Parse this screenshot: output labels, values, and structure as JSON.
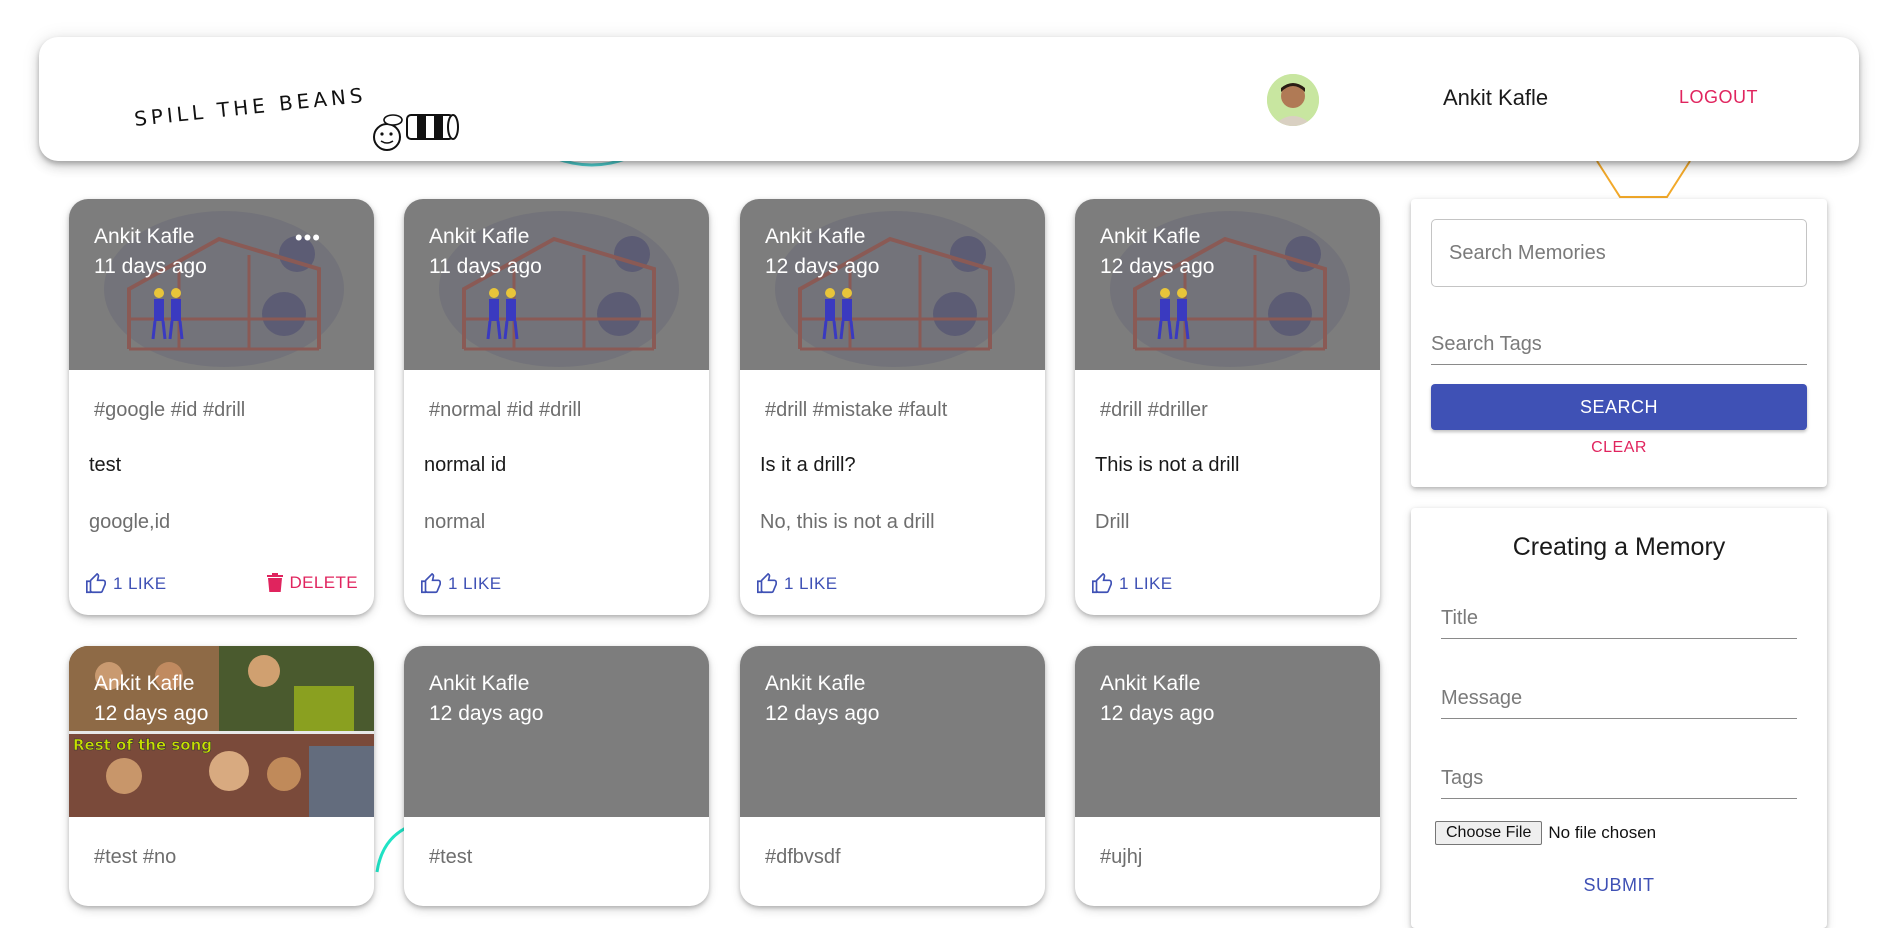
{
  "header": {
    "logo_text": "SPILL THE BEANS",
    "user_name": "Ankit Kafle",
    "logout_label": "LOGOUT"
  },
  "posts": [
    {
      "author": "Ankit Kafle",
      "time": "11 days ago",
      "tags": "#google #id #drill",
      "title": "test",
      "message": "google,id",
      "likes": "1 LIKE",
      "delete": "DELETE",
      "image": "illustration"
    },
    {
      "author": "Ankit Kafle",
      "time": "11 days ago",
      "tags": "#normal #id #drill",
      "title": "normal id",
      "message": "normal",
      "likes": "1 LIKE",
      "image": "illustration"
    },
    {
      "author": "Ankit Kafle",
      "time": "12 days ago",
      "tags": "#drill #mistake #fault",
      "title": "Is it a drill?",
      "message": "No, this is not a drill",
      "likes": "1 LIKE",
      "image": "illustration"
    },
    {
      "author": "Ankit Kafle",
      "time": "12 days ago",
      "tags": "#drill #driller",
      "title": "This is not a drill",
      "message": "Drill",
      "likes": "1 LIKE",
      "image": "illustration"
    },
    {
      "author": "Ankit Kafle",
      "time": "12 days ago",
      "tags": "#test #no",
      "meme_caption": "Rest of the song",
      "image": "meme-photo"
    },
    {
      "author": "Ankit Kafle",
      "time": "12 days ago",
      "tags": "#test",
      "image": "none"
    },
    {
      "author": "Ankit Kafle",
      "time": "12 days ago",
      "tags": "#dfbvsdf",
      "image": "none"
    },
    {
      "author": "Ankit Kafle",
      "time": "12 days ago",
      "tags": "#ujhj",
      "image": "none"
    }
  ],
  "search": {
    "memories_placeholder": "Search Memories",
    "tags_placeholder": "Search Tags",
    "search_label": "SEARCH",
    "clear_label": "CLEAR"
  },
  "form": {
    "heading": "Creating a Memory",
    "title_placeholder": "Title",
    "message_placeholder": "Message",
    "tags_placeholder": "Tags",
    "file_button": "Choose File",
    "file_status": "No file chosen",
    "submit_label": "SUBMIT"
  },
  "colors": {
    "primary": "#3f51b5",
    "secondary": "#e0245e",
    "card_media_gray": "#7d7d7d"
  }
}
